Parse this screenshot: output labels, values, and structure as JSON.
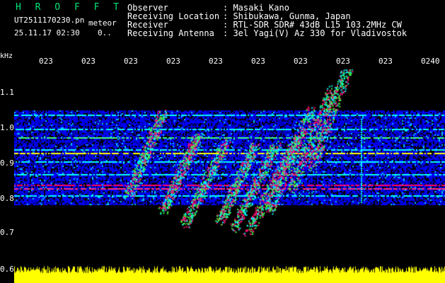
{
  "header": {
    "brand": "H R O F F T",
    "filename": "UT2511170230.pn",
    "mode_label": "meteor",
    "date_time": "25.11.17 02:30",
    "counter": "0..",
    "fields": [
      {
        "label": "Observer",
        "value": "Masaki Kano"
      },
      {
        "label": "Receiving Location",
        "value": "Shibukawa, Gunma, Japan"
      },
      {
        "label": "Receiver",
        "value": "RTL-SDR SDR# 43dB L15 103.2MHz CW"
      },
      {
        "label": "Receiving Antenna",
        "value": "3el Yagi(V) Az 330 for Vladivostok"
      }
    ]
  },
  "spectrogram": {
    "freq_unit": "kHz",
    "freq_ticks": [
      "1.1",
      "1.0",
      "0.9",
      "0.8",
      "0.7",
      "0.6"
    ],
    "time_ticks": [
      "023",
      "023",
      "023",
      "023",
      "023",
      "023",
      "023",
      "023",
      "023",
      "0240"
    ],
    "colors": {
      "background": "#000080",
      "noise": "#0000ff",
      "mid": "#00ffff",
      "high": "#ff0080",
      "level": "#ffff00"
    }
  }
}
